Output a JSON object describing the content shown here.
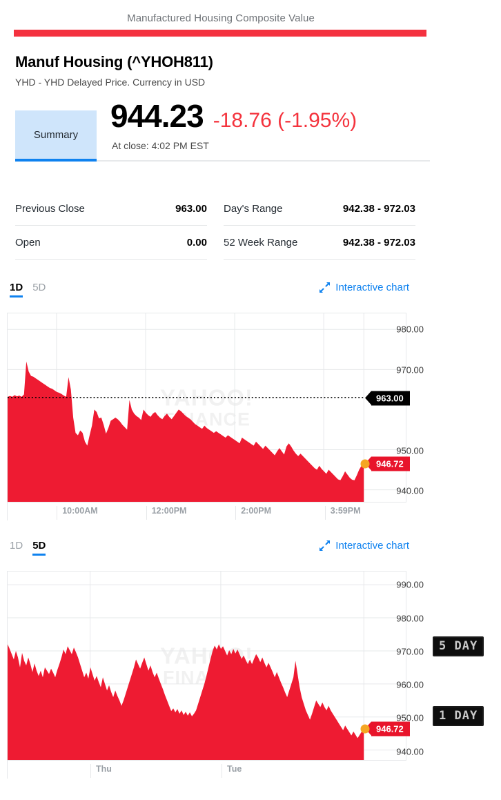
{
  "page": {
    "title": "Manufactured Housing Composite Value",
    "brand_color": "#f4313f"
  },
  "quote": {
    "name": "Manuf Housing (^YHOH811)",
    "subtitle": "YHD - YHD Delayed Price. Currency in USD",
    "price": "944.23",
    "change": "-18.76 (-1.95%)",
    "change_color": "#f4333d",
    "as_of": "At close: 4:02 PM EST",
    "summary_tab": "Summary"
  },
  "stats": {
    "left": [
      {
        "label": "Previous Close",
        "value": "963.00"
      },
      {
        "label": "Open",
        "value": "0.00"
      }
    ],
    "right": [
      {
        "label": "Day's Range",
        "value": "942.38 - 972.03"
      },
      {
        "label": "52 Week Range",
        "value": "942.38 - 972.03"
      }
    ]
  },
  "charts": {
    "interactive_label": "Interactive chart",
    "expand_icon": "expand-arrows-icon",
    "one_day": {
      "tabs": [
        {
          "label": "1D",
          "active": true
        },
        {
          "label": "5D",
          "active": false
        }
      ],
      "annotation_badge": "1 DAY",
      "prev_close_tag": "963.00",
      "last_price_tag": "946.72",
      "watermark_line1": "YAHOO!",
      "watermark_line2": "FINANCE"
    },
    "five_day": {
      "tabs": [
        {
          "label": "1D",
          "active": false
        },
        {
          "label": "5D",
          "active": true
        }
      ],
      "annotation_badge": "5 DAY",
      "last_price_tag": "946.72",
      "watermark_line1": "YAHOO!",
      "watermark_line2": "FINANCE"
    }
  },
  "chart_data": [
    {
      "type": "area",
      "id": "1d",
      "title": "Manuf Housing (^YHOH811) - 1 Day",
      "xlabel": "",
      "ylabel": "",
      "ylim": [
        937,
        984
      ],
      "yticks": [
        980.0,
        970.0,
        950.0,
        940.0
      ],
      "ytick_labels": [
        "980.00",
        "970.00",
        "950.00",
        "940.00"
      ],
      "x_ticks": [
        "10:00AM",
        "12:00PM",
        "2:00PM",
        "3:59PM"
      ],
      "grid": true,
      "legend": "none",
      "line_color": "#e8142b",
      "fill_color": "#ee1b32",
      "reference_line": {
        "value": 963.0,
        "label": "963.00",
        "style": "dotted",
        "color": "#000000"
      },
      "last_point": {
        "value": 946.72,
        "label": "946.72",
        "marker_color": "#f5a623"
      },
      "values": [
        963.2,
        963.4,
        963.2,
        963.6,
        963.3,
        963.5,
        963.2,
        963.8,
        972.0,
        969.5,
        968.4,
        968.2,
        967.8,
        967.4,
        967.0,
        966.6,
        966.2,
        965.8,
        965.4,
        965.2,
        964.8,
        964.4,
        964.2,
        963.9,
        963.5,
        963.2,
        968.1,
        965.0,
        958.0,
        954.2,
        953.6,
        954.8,
        954.2,
        952.0,
        951.0,
        953.6,
        956.0,
        960.0,
        959.4,
        957.8,
        958.0,
        956.2,
        954.0,
        955.4,
        957.2,
        957.6,
        958.0,
        957.6,
        957.0,
        956.2,
        955.6,
        955.0,
        962.4,
        960.0,
        959.0,
        958.4,
        958.0,
        957.4,
        960.0,
        959.2,
        958.6,
        958.2,
        959.0,
        959.4,
        958.6,
        958.0,
        957.6,
        958.4,
        959.0,
        958.2,
        957.6,
        958.4,
        959.2,
        960.0,
        959.6,
        959.0,
        958.4,
        958.0,
        957.6,
        957.0,
        956.4,
        956.0,
        955.6,
        955.2,
        956.0,
        955.4,
        955.0,
        954.6,
        954.2,
        954.6,
        954.2,
        953.8,
        953.4,
        953.0,
        953.6,
        953.2,
        952.8,
        952.4,
        952.0,
        951.6,
        953.0,
        952.6,
        952.2,
        951.8,
        951.4,
        951.0,
        952.0,
        951.4,
        950.8,
        950.2,
        951.0,
        950.4,
        949.8,
        949.2,
        948.6,
        949.6,
        950.4,
        949.6,
        948.8,
        950.8,
        951.6,
        950.8,
        949.8,
        949.0,
        948.4,
        949.0,
        948.4,
        947.8,
        947.2,
        946.6,
        946.0,
        945.4,
        945.0,
        946.0,
        945.2,
        944.6,
        944.0,
        945.0,
        944.4,
        943.8,
        943.2,
        942.6,
        942.4,
        943.4,
        944.6,
        943.8,
        943.0,
        942.5,
        942.38,
        943.6,
        945.0,
        946.0,
        946.72
      ]
    },
    {
      "type": "area",
      "id": "5d",
      "title": "Manuf Housing (^YHOH811) - 5 Day",
      "xlabel": "",
      "ylabel": "",
      "ylim": [
        937,
        994
      ],
      "yticks": [
        990.0,
        980.0,
        970.0,
        960.0,
        950.0,
        940.0
      ],
      "ytick_labels": [
        "990.00",
        "980.00",
        "970.00",
        "960.00",
        "950.00",
        "940.00"
      ],
      "x_ticks": [
        "Thu",
        "Tue"
      ],
      "grid": true,
      "legend": "none",
      "line_color": "#e8142b",
      "fill_color": "#ee1b32",
      "last_point": {
        "value": 946.72,
        "label": "946.72",
        "marker_color": "#f5a623"
      },
      "values": [
        972.0,
        970.6,
        969.0,
        967.4,
        970.0,
        968.0,
        965.0,
        969.4,
        967.0,
        965.6,
        968.0,
        966.0,
        963.6,
        966.2,
        964.0,
        962.4,
        964.0,
        962.0,
        965.0,
        964.0,
        963.0,
        964.6,
        963.4,
        962.0,
        964.2,
        966.0,
        968.0,
        970.4,
        969.0,
        971.4,
        970.2,
        969.0,
        971.0,
        969.6,
        968.0,
        966.0,
        964.0,
        962.0,
        963.4,
        961.6,
        965.0,
        963.0,
        961.0,
        962.4,
        960.6,
        959.0,
        962.0,
        960.0,
        958.0,
        959.6,
        957.6,
        956.0,
        958.0,
        956.4,
        955.0,
        953.4,
        955.0,
        957.0,
        959.0,
        961.0,
        963.0,
        965.0,
        967.4,
        966.0,
        964.6,
        966.4,
        968.0,
        966.0,
        964.0,
        965.6,
        963.6,
        962.0,
        963.4,
        961.6,
        960.0,
        958.4,
        956.6,
        955.0,
        953.4,
        951.8,
        952.6,
        951.4,
        952.4,
        951.0,
        952.0,
        950.6,
        951.6,
        950.4,
        951.4,
        950.2,
        951.0,
        952.0,
        954.0,
        956.0,
        958.0,
        960.0,
        962.4,
        965.0,
        967.6,
        970.0,
        971.6,
        970.4,
        972.0,
        970.6,
        971.4,
        970.0,
        968.6,
        970.2,
        969.0,
        970.6,
        969.2,
        970.4,
        969.0,
        967.6,
        968.6,
        967.2,
        966.0,
        967.4,
        966.0,
        967.6,
        969.0,
        968.0,
        966.6,
        968.0,
        966.4,
        965.0,
        966.4,
        965.0,
        963.6,
        962.0,
        963.6,
        962.0,
        960.4,
        959.0,
        957.4,
        956.0,
        958.0,
        960.0,
        962.0,
        967.0,
        963.0,
        959.0,
        956.0,
        954.0,
        952.0,
        950.6,
        949.2,
        951.0,
        953.0,
        955.0,
        954.0,
        953.0,
        954.4,
        953.0,
        952.0,
        953.4,
        952.0,
        951.0,
        950.0,
        949.0,
        948.0,
        947.0,
        946.0,
        947.4,
        946.4,
        945.4,
        944.4,
        945.6,
        944.6,
        943.6,
        944.6,
        945.6,
        946.72
      ]
    }
  ]
}
